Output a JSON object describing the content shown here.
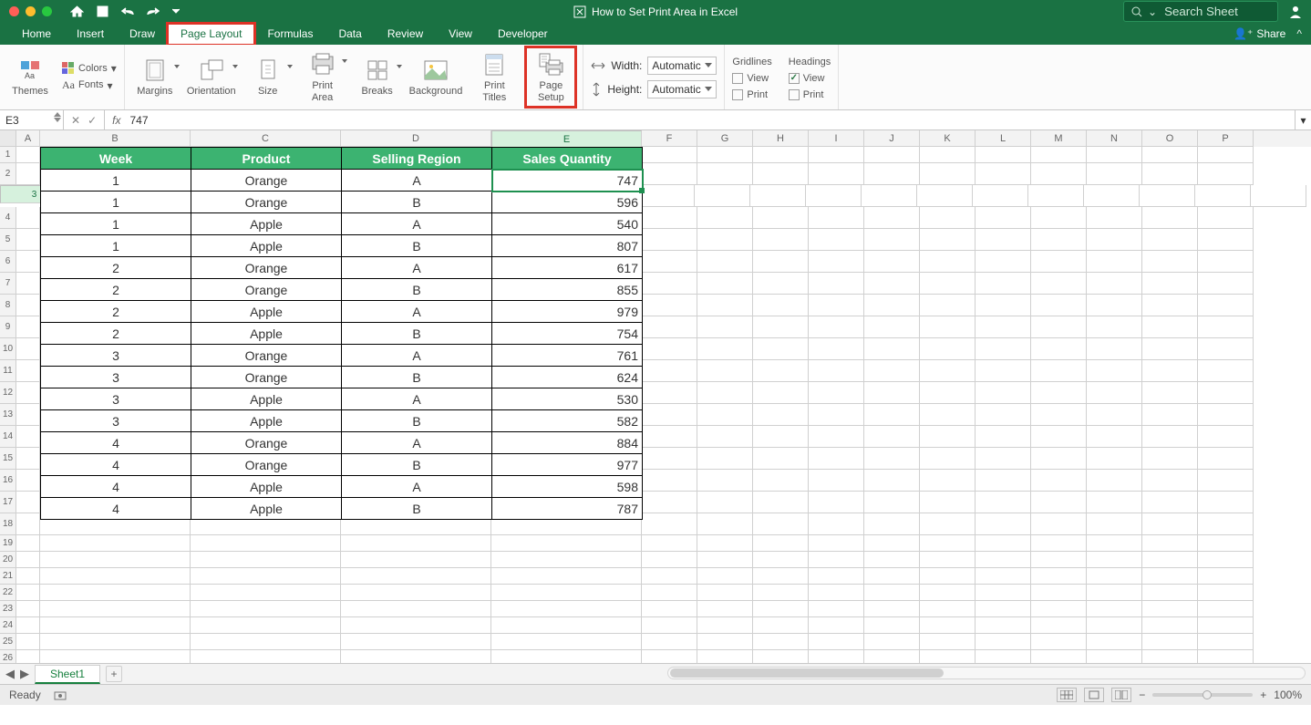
{
  "window": {
    "title": "How to Set Print Area in Excel"
  },
  "search": {
    "placeholder": "Search Sheet"
  },
  "tabs": {
    "items": [
      "Home",
      "Insert",
      "Draw",
      "Page Layout",
      "Formulas",
      "Data",
      "Review",
      "View",
      "Developer"
    ],
    "active": "Page Layout",
    "share": "Share"
  },
  "ribbon": {
    "themes": "Themes",
    "colors": "Colors",
    "fonts": "Fonts",
    "margins": "Margins",
    "orientation": "Orientation",
    "size": "Size",
    "printArea": "Print Area",
    "breaks": "Breaks",
    "background": "Background",
    "printTitles": "Print Titles",
    "pageSetup": "Page Setup",
    "width": "Width:",
    "height": "Height:",
    "widthSel": "Automatic",
    "heightSel": "Automatic",
    "gridlines": "Gridlines",
    "headings": "Headings",
    "view": "View",
    "print": "Print"
  },
  "namebox": "E3",
  "formula": "747",
  "columns": [
    "A",
    "B",
    "C",
    "D",
    "E",
    "F",
    "G",
    "H",
    "I",
    "J",
    "K",
    "L",
    "M",
    "N",
    "O",
    "P"
  ],
  "rowcount": 28,
  "selected": {
    "col": "E",
    "row": 3
  },
  "table": {
    "headers": [
      "Week",
      "Product",
      "Selling Region",
      "Sales Quantity"
    ],
    "rows": [
      [
        1,
        "Orange",
        "A",
        747
      ],
      [
        1,
        "Orange",
        "B",
        596
      ],
      [
        1,
        "Apple",
        "A",
        540
      ],
      [
        1,
        "Apple",
        "B",
        807
      ],
      [
        2,
        "Orange",
        "A",
        617
      ],
      [
        2,
        "Orange",
        "B",
        855
      ],
      [
        2,
        "Apple",
        "A",
        979
      ],
      [
        2,
        "Apple",
        "B",
        754
      ],
      [
        3,
        "Orange",
        "A",
        761
      ],
      [
        3,
        "Orange",
        "B",
        624
      ],
      [
        3,
        "Apple",
        "A",
        530
      ],
      [
        3,
        "Apple",
        "B",
        582
      ],
      [
        4,
        "Orange",
        "A",
        884
      ],
      [
        4,
        "Orange",
        "B",
        977
      ],
      [
        4,
        "Apple",
        "A",
        598
      ],
      [
        4,
        "Apple",
        "B",
        787
      ]
    ]
  },
  "sheets": {
    "active": "Sheet1"
  },
  "status": {
    "ready": "Ready",
    "zoom": "100%"
  }
}
